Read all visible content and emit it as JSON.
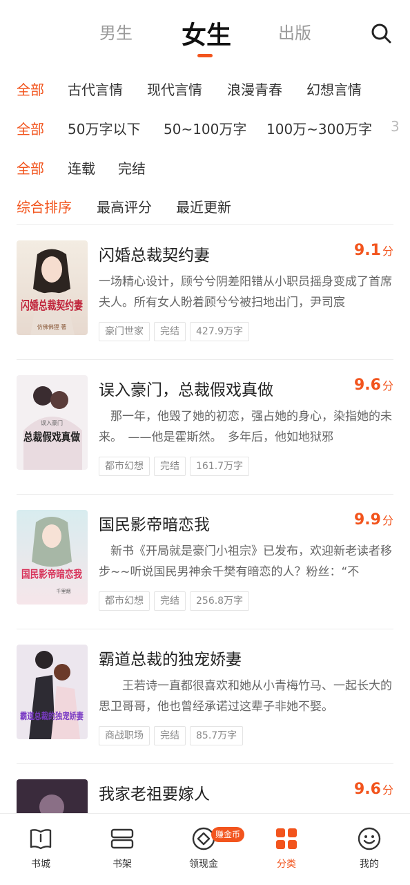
{
  "top_tabs": [
    {
      "label": "男生",
      "active": false
    },
    {
      "label": "女生",
      "active": true
    },
    {
      "label": "出版",
      "active": false
    }
  ],
  "filters": {
    "category": [
      "全部",
      "古代言情",
      "现代言情",
      "浪漫青春",
      "幻想言情"
    ],
    "word_count": [
      "全部",
      "50万字以下",
      "50~100万字",
      "100万~300万字",
      "3"
    ],
    "status": [
      "全部",
      "连载",
      "完结"
    ],
    "sort": [
      "综合排序",
      "最高评分",
      "最近更新"
    ]
  },
  "books": [
    {
      "title": "闪婚总裁契约妻",
      "score": "9.1",
      "score_unit": "分",
      "desc": "一场精心设计，顾兮兮阴差阳错从小职员摇身变成了首席夫人。所有女人盼着顾兮兮被扫地出门，尹司宸",
      "tags": [
        "豪门世家",
        "完结",
        "427.9万字"
      ],
      "cover_text": "闪婚总裁契约妻",
      "cover_author": "仿佛佛狸 著"
    },
    {
      "title": "误入豪门，总裁假戏真做",
      "score": "9.6",
      "score_unit": "分",
      "desc": "　那一年，他毁了她的初恋，强占她的身心，染指她的未来。　——他是霍斯然。　多年后，他如地狱邪",
      "tags": [
        "都市幻想",
        "完结",
        "161.7万字"
      ],
      "cover_text": "总裁假戏真做",
      "cover_author": "误入豪门"
    },
    {
      "title": "国民影帝暗恋我",
      "score": "9.9",
      "score_unit": "分",
      "desc": "　新书《开局就是豪门小祖宗》已发布，欢迎新老读者移步~~听说国民男神余千樊有暗恋的人？粉丝：“不",
      "tags": [
        "都市幻想",
        "完结",
        "256.8万字"
      ],
      "cover_text": "国民影帝暗恋我",
      "cover_author": "千里烟"
    },
    {
      "title": "霸道总裁的独宠娇妻",
      "score": "",
      "score_unit": "",
      "desc": "　　王若诗一直都很喜欢和她从小青梅竹马、一起长大的思卫哥哥，他也曾经承诺过这辈子非她不娶。",
      "tags": [
        "商战职场",
        "完结",
        "85.7万字"
      ],
      "cover_text": "霸道总裁的独宠娇妻",
      "cover_author": ""
    },
    {
      "title": "我家老祖要嫁人",
      "score": "9.6",
      "score_unit": "分",
      "desc": "",
      "tags": [],
      "cover_text": "",
      "cover_author": ""
    }
  ],
  "bottom_nav": [
    {
      "label": "书城",
      "icon": "book-icon",
      "active": false
    },
    {
      "label": "书架",
      "icon": "bookshelf-icon",
      "active": false
    },
    {
      "label": "领现金",
      "icon": "cash-icon",
      "active": false
    },
    {
      "label": "分类",
      "icon": "category-grid-icon",
      "active": true
    },
    {
      "label": "我的",
      "icon": "smile-face-icon",
      "active": false
    }
  ],
  "coin_badge": "赚金币",
  "colors": {
    "accent": "#f2541d",
    "text": "#333333",
    "muted": "#9a9a9a"
  }
}
